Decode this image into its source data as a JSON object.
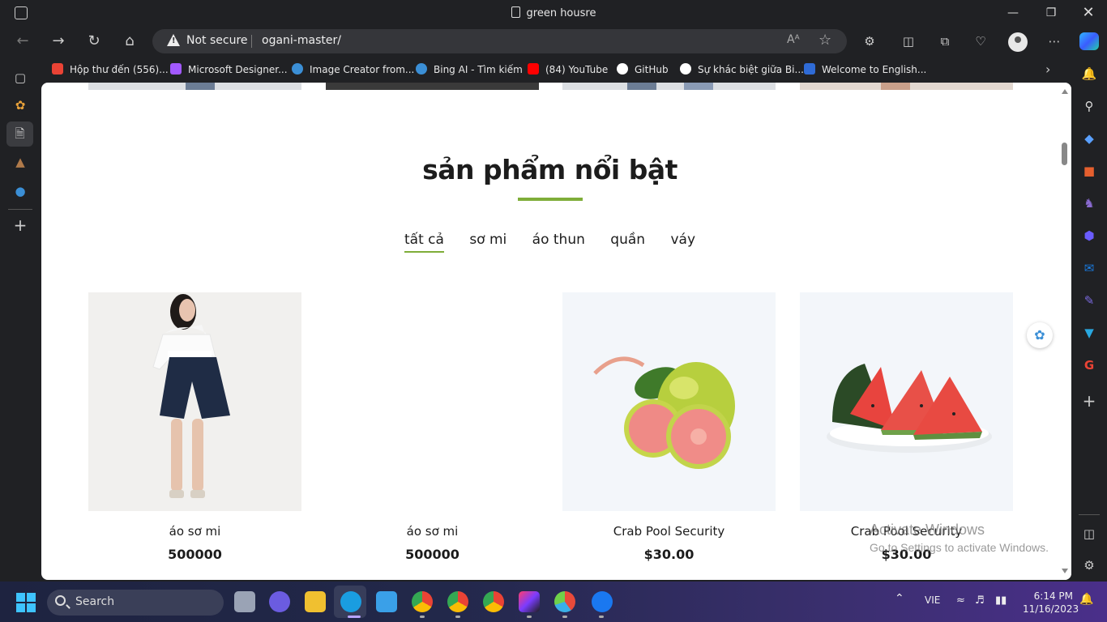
{
  "window": {
    "title": "green housre"
  },
  "toolbar": {
    "security_label": "Not secure",
    "url": "ogani-master/"
  },
  "bookmarks": [
    {
      "label": "Hộp thư đến (556)...",
      "icon": "gmail-icon",
      "color": "#ea4335"
    },
    {
      "label": "Microsoft Designer...",
      "icon": "designer-icon",
      "color": "#a259ff"
    },
    {
      "label": "Image Creator from...",
      "icon": "bing-search-icon",
      "color": "#3b8fd6"
    },
    {
      "label": "Bing AI - Tìm kiếm",
      "icon": "bing-search-icon",
      "color": "#3b8fd6"
    },
    {
      "label": "(84) YouTube",
      "icon": "youtube-icon",
      "color": "#ff0000"
    },
    {
      "label": "GitHub",
      "icon": "github-icon",
      "color": "#ffffff"
    },
    {
      "label": "Sự khác biệt giữa Bi...",
      "icon": "site-icon",
      "color": "#ffffff"
    },
    {
      "label": "Welcome to English...",
      "icon": "site-icon",
      "color": "#2f6bd6"
    }
  ],
  "page": {
    "section_title": "sản phẩm nổi bật",
    "filters": [
      "tất cả",
      "sơ mi",
      "áo thun",
      "quần",
      "váy"
    ],
    "accent_color": "#7fad39",
    "products": [
      {
        "name": "áo sơ mi",
        "price": "500000",
        "image": "woman-in-white-shirt-and-navy-shorts"
      },
      {
        "name": "áo sơ mi",
        "price": "500000",
        "image": "empty"
      },
      {
        "name": "Crab Pool Security",
        "price": "$30.00",
        "image": "guava-fruit"
      },
      {
        "name": "Crab Pool Security",
        "price": "$30.00",
        "image": "watermelon-slices-on-plate"
      }
    ]
  },
  "watermark": {
    "line1": "Activate Windows",
    "line2": "Go to Settings to activate Windows."
  },
  "taskbar": {
    "search_label": "Search",
    "language": "VIE",
    "time": "6:14 PM",
    "date": "11/16/2023"
  }
}
